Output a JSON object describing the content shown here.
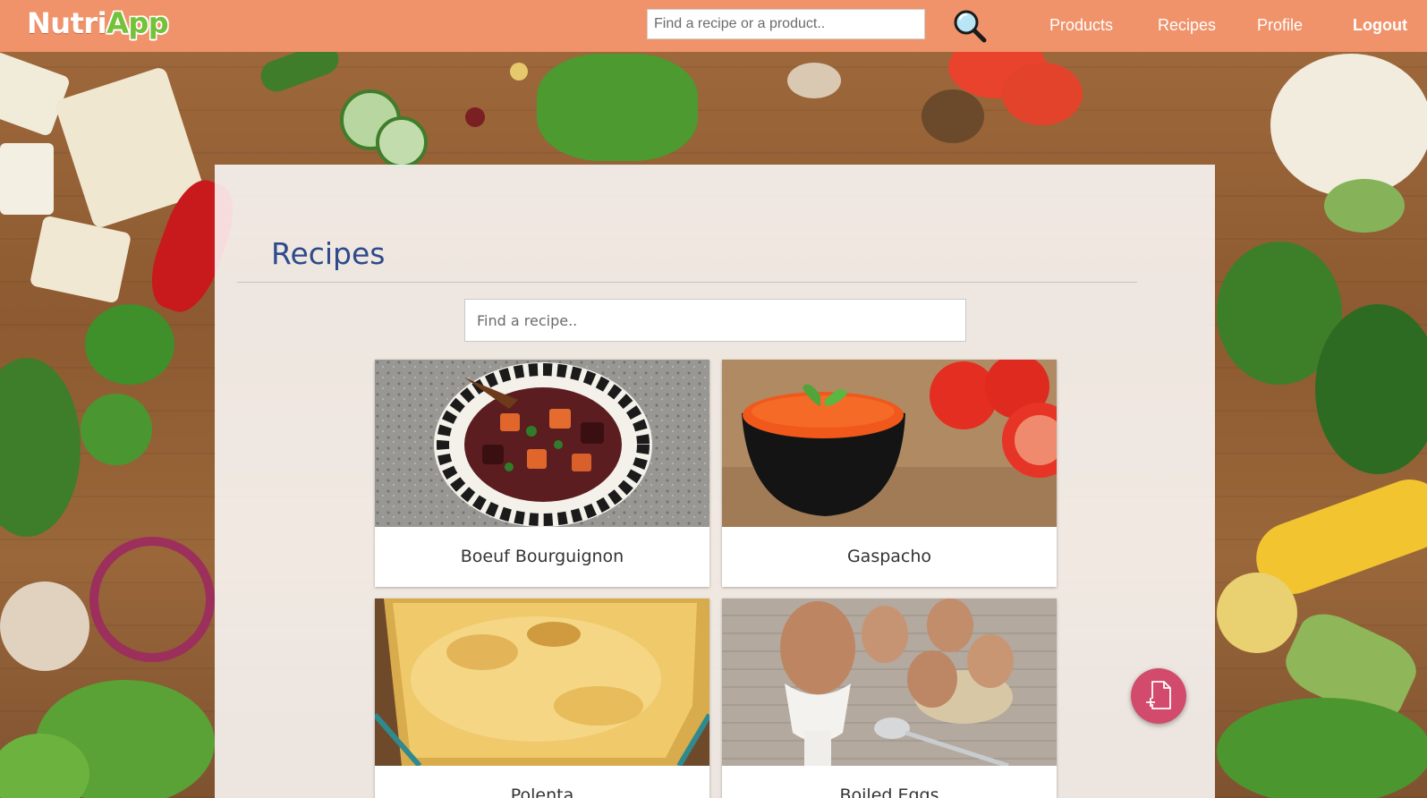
{
  "app": {
    "logo_part1": "Nutri",
    "logo_part2": "App"
  },
  "header": {
    "search_placeholder": "Find a recipe or a product..",
    "nav": {
      "products": "Products",
      "recipes": "Recipes",
      "profile": "Profile",
      "logout": "Logout"
    }
  },
  "page": {
    "title": "Recipes",
    "search_placeholder": "Find a recipe.."
  },
  "recipes": [
    {
      "name": "Boeuf Bourguignon",
      "icon": "beef-stew-image"
    },
    {
      "name": "Gaspacho",
      "icon": "gazpacho-image"
    },
    {
      "name": "Polenta",
      "icon": "polenta-image"
    },
    {
      "name": "Boiled Eggs",
      "icon": "boiled-eggs-image"
    }
  ],
  "colors": {
    "header": "#f0936b",
    "logo_accent": "#74c23a",
    "title": "#2d4a8a",
    "fab": "#d24a6c"
  }
}
